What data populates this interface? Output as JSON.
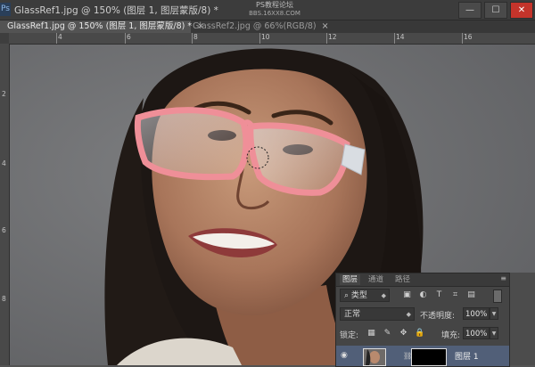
{
  "window": {
    "title": "GlassRef1.jpg @ 150% (图层 1, 图层蒙版/8) *",
    "watermark_line1": "PS教程论坛",
    "watermark_line2": "BBS.16XX8.COM",
    "minimize": "—",
    "maximize": "☐",
    "close": "✕"
  },
  "tabs": [
    {
      "label": "GlassRef1.jpg @ 150% (图层 1, 图层蒙版/8) *",
      "close": "×",
      "active": true
    },
    {
      "label": "GlassRef2.jpg @ 66%(RGB/8)",
      "close": "×",
      "active": false
    }
  ],
  "ruler_top_ticks": [
    "4",
    "6",
    "8",
    "10",
    "12",
    "14",
    "16"
  ],
  "ruler_left_ticks": [
    "2",
    "4",
    "6",
    "8"
  ],
  "layers_panel": {
    "tabs": [
      "图层",
      "通道",
      "路径"
    ],
    "menu_icon": "≡",
    "filter_kind": "类型",
    "blend_mode": "正常",
    "opacity_label": "不透明度:",
    "opacity_value": "100%",
    "lock_label": "锁定:",
    "fill_label": "填充:",
    "fill_value": "100%",
    "layer_name": "图层 1"
  },
  "colors": {
    "accent_selected": "#515f78",
    "close_red": "#c4342b",
    "glasses_frame": "#ef8f98"
  }
}
